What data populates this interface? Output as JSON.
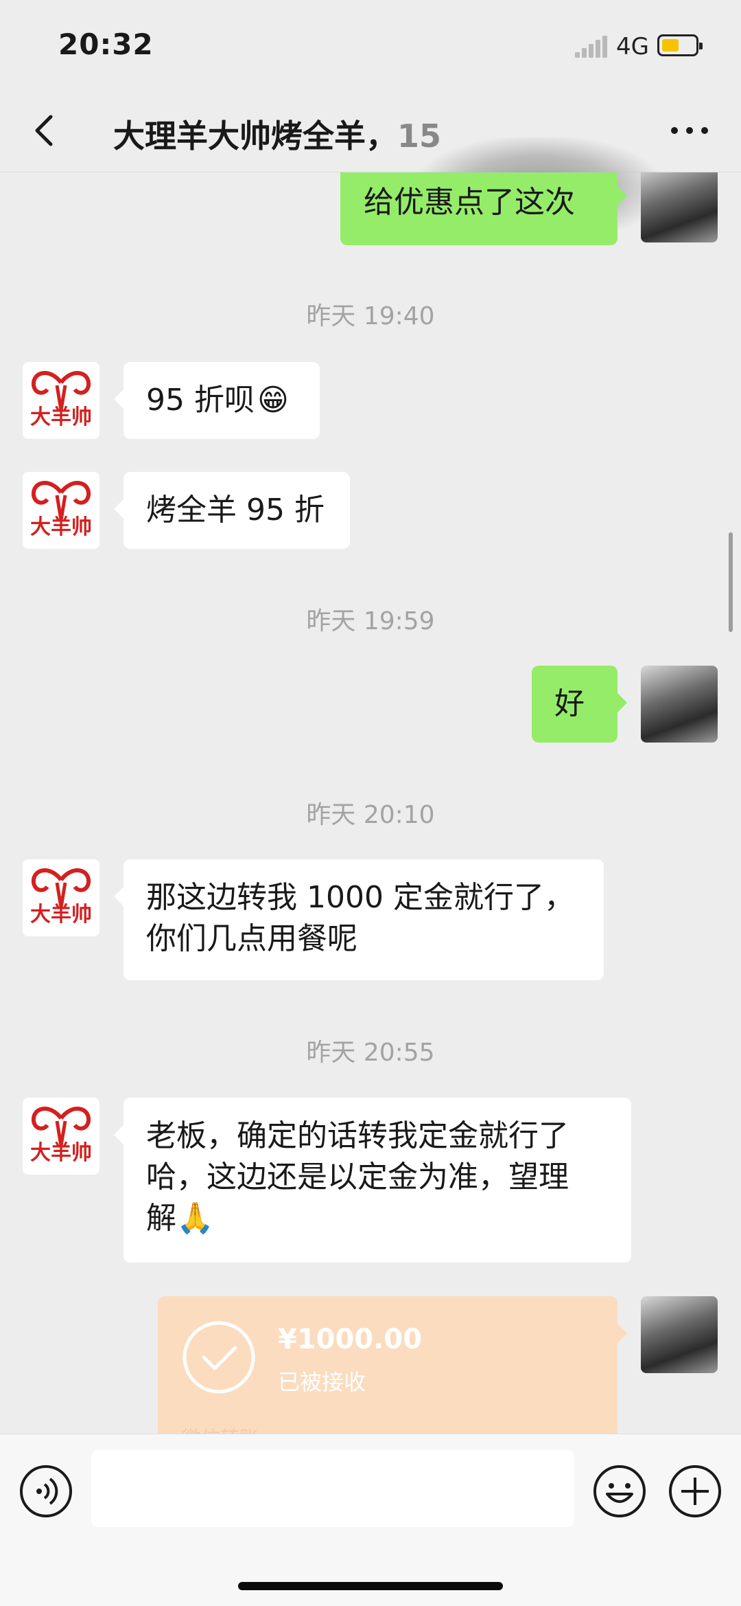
{
  "status_bar": {
    "time": "20:32",
    "network": "4G"
  },
  "navbar": {
    "title": "大理羊大帅烤全羊，",
    "title_partial": "15"
  },
  "chat": {
    "messages": [
      {
        "type": "outgoing",
        "text": "给优惠点了这次"
      },
      {
        "type": "timestamp",
        "text": "昨天 19:40"
      },
      {
        "type": "incoming",
        "text": "95 折呗",
        "emoji": "😁"
      },
      {
        "type": "incoming",
        "text": "烤全羊 95 折"
      },
      {
        "type": "timestamp",
        "text": "昨天 19:59"
      },
      {
        "type": "outgoing",
        "text": "好"
      },
      {
        "type": "timestamp",
        "text": "昨天 20:10"
      },
      {
        "type": "incoming",
        "lines": [
          "那这边转我 1000 定金就行了，",
          "你们几点用餐呢"
        ]
      },
      {
        "type": "timestamp",
        "text": "昨天 20:55"
      },
      {
        "type": "incoming",
        "lines": [
          "老板，确定的话转我定金就行了",
          "哈，这边还是以定金为准，望理",
          "解"
        ],
        "emoji": "🙏"
      },
      {
        "type": "transfer",
        "amount": "¥1000.00",
        "status": "已被接收",
        "footer": "微信转账"
      }
    ]
  },
  "avatar_logo_text": "大羊帅",
  "input_bar": {
    "text": ""
  },
  "colors": {
    "outgoing_bubble": "#95ec69",
    "incoming_bubble": "#ffffff",
    "transfer_card": "#fbdcbf",
    "logo_red": "#d42020"
  },
  "icons": [
    "back-chevron-icon",
    "more-icon",
    "voice-icon",
    "emoji-icon",
    "plus-icon",
    "check-circle-icon"
  ]
}
